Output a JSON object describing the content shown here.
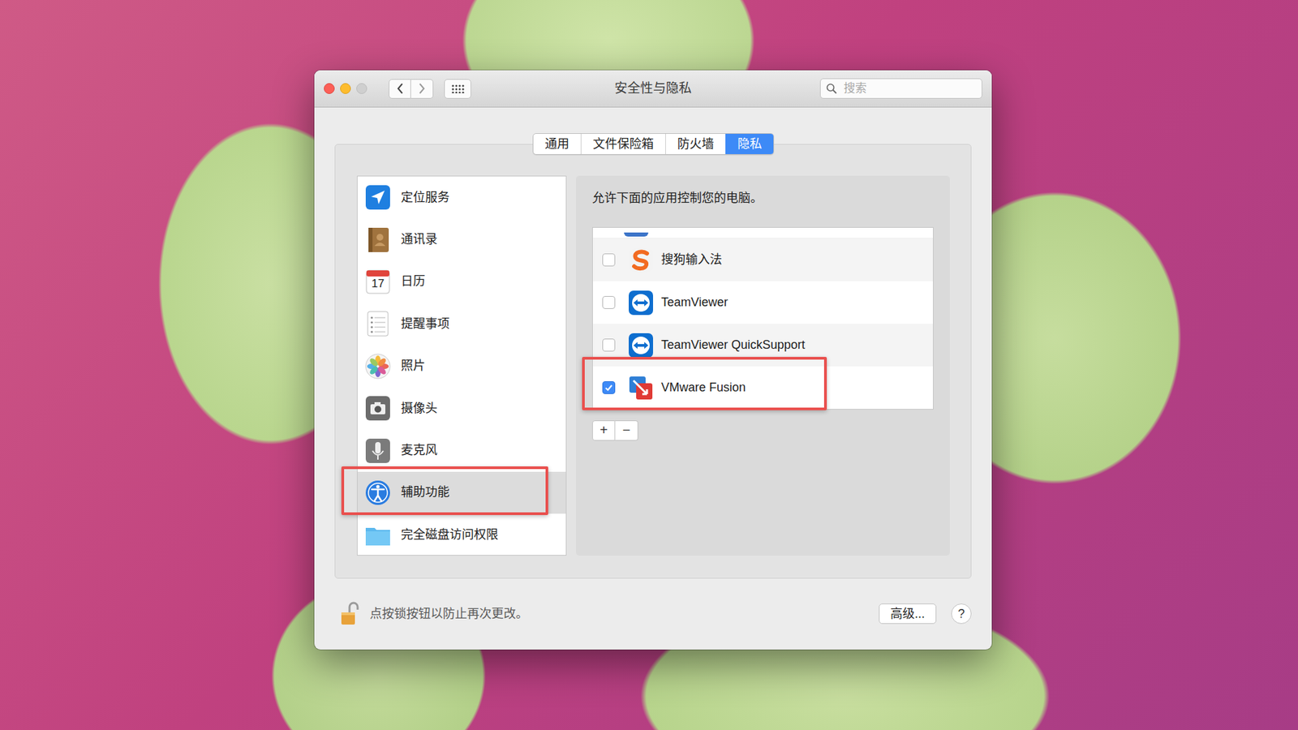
{
  "window": {
    "title": "安全性与隐私"
  },
  "search": {
    "placeholder": "搜索"
  },
  "tabs": [
    {
      "label": "通用",
      "selected": false
    },
    {
      "label": "文件保险箱",
      "selected": false
    },
    {
      "label": "防火墙",
      "selected": false
    },
    {
      "label": "隐私",
      "selected": true
    }
  ],
  "sidebar": {
    "items": [
      {
        "label": "定位服务",
        "selected": false,
        "annotated": false
      },
      {
        "label": "通讯录",
        "selected": false,
        "annotated": false
      },
      {
        "label": "日历",
        "selected": false,
        "annotated": false,
        "icon_text": "17"
      },
      {
        "label": "提醒事项",
        "selected": false,
        "annotated": false
      },
      {
        "label": "照片",
        "selected": false,
        "annotated": false
      },
      {
        "label": "摄像头",
        "selected": false,
        "annotated": false
      },
      {
        "label": "麦克风",
        "selected": false,
        "annotated": false
      },
      {
        "label": "辅助功能",
        "selected": true,
        "annotated": true
      },
      {
        "label": "完全磁盘访问权限",
        "selected": false,
        "annotated": false
      }
    ]
  },
  "apps": {
    "description": "允许下面的应用控制您的电脑。",
    "items": [
      {
        "name": "搜狗输入法",
        "checked": false,
        "annotated": false
      },
      {
        "name": "TeamViewer",
        "checked": false,
        "annotated": false
      },
      {
        "name": "TeamViewer QuickSupport",
        "checked": false,
        "annotated": false
      },
      {
        "name": "VMware Fusion",
        "checked": true,
        "annotated": true
      }
    ],
    "buttons": [
      "+",
      "−"
    ]
  },
  "footer": {
    "lock_text": "点按锁按钮以防止再次更改。",
    "locked": false,
    "advanced": "高级...",
    "help": "?"
  }
}
